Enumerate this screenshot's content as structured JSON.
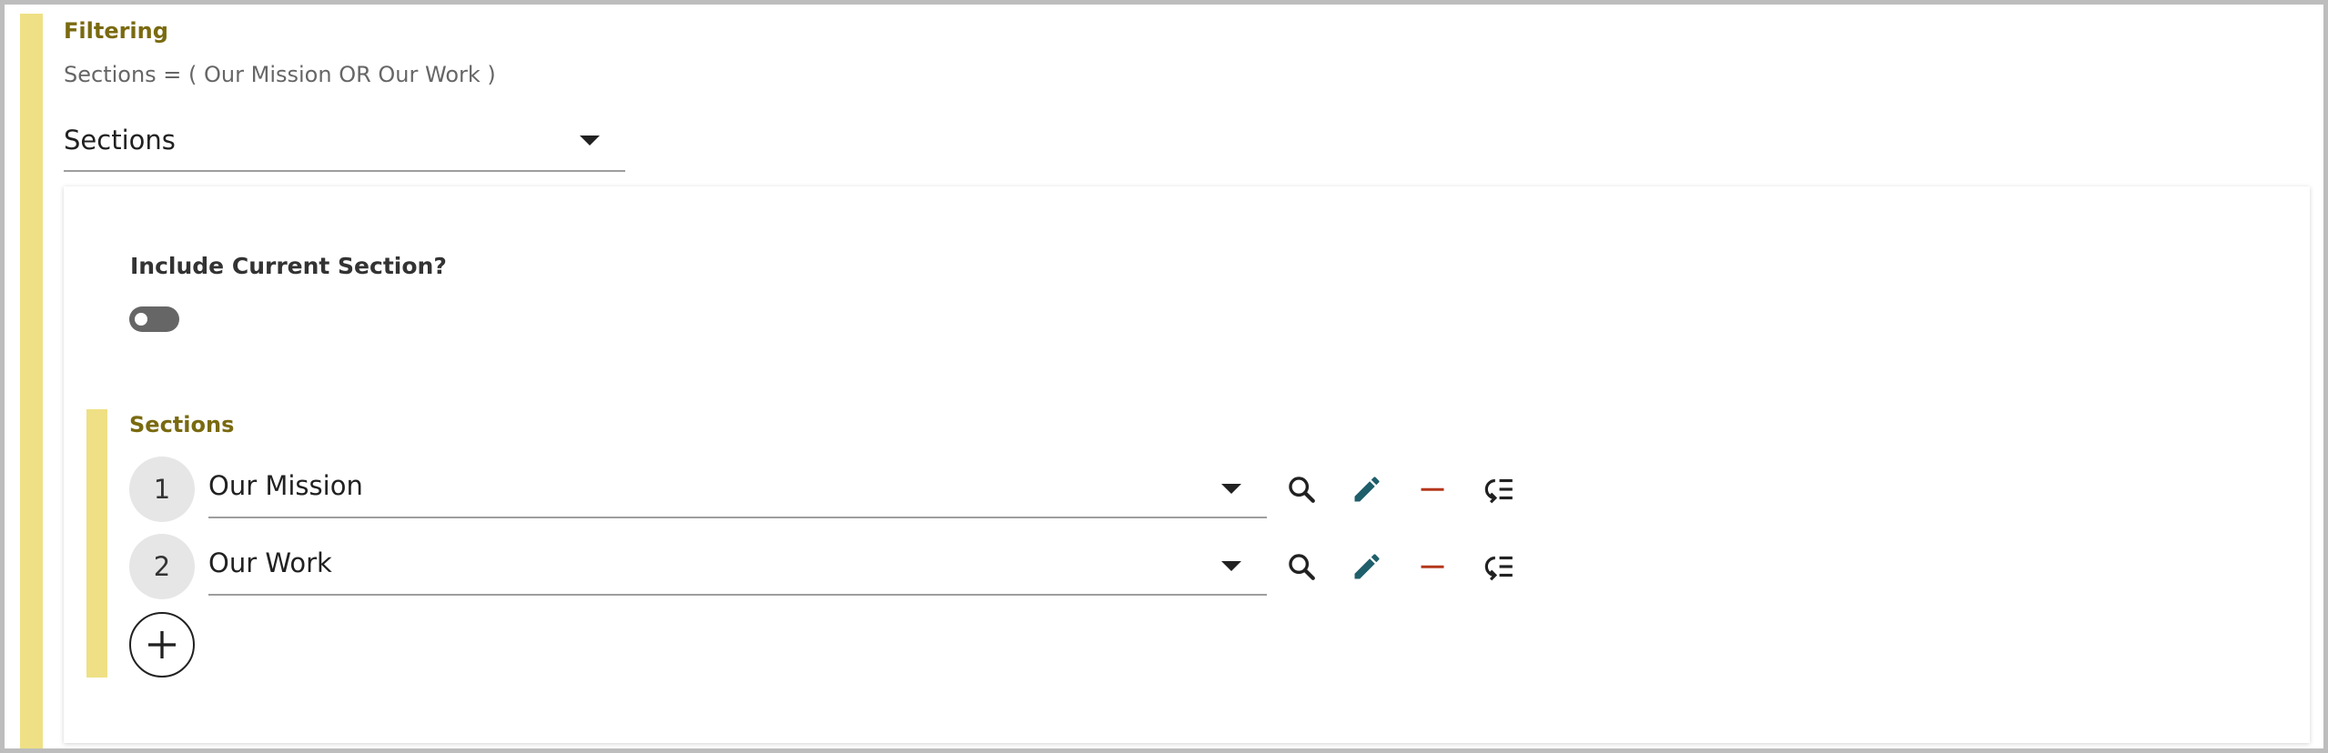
{
  "filtering": {
    "title": "Filtering",
    "summary": "Sections = ( Our Mission OR Our Work )",
    "select_value": "Sections"
  },
  "options": {
    "include_label": "Include Current Section?",
    "include_toggle": "off"
  },
  "sections": {
    "title": "Sections",
    "rows": [
      {
        "index": "1",
        "value": "Our Mission"
      },
      {
        "index": "2",
        "value": "Our Work"
      }
    ]
  },
  "colors": {
    "accent_bar": "#efe085",
    "title_text": "#7a6a10",
    "edit_icon": "#1f5f6b",
    "remove_icon": "#b3361b"
  },
  "icons": [
    "search-icon",
    "edit-pencil-icon",
    "remove-minus-icon",
    "reorder-list-icon",
    "add-plus-icon",
    "chevron-down-icon"
  ]
}
